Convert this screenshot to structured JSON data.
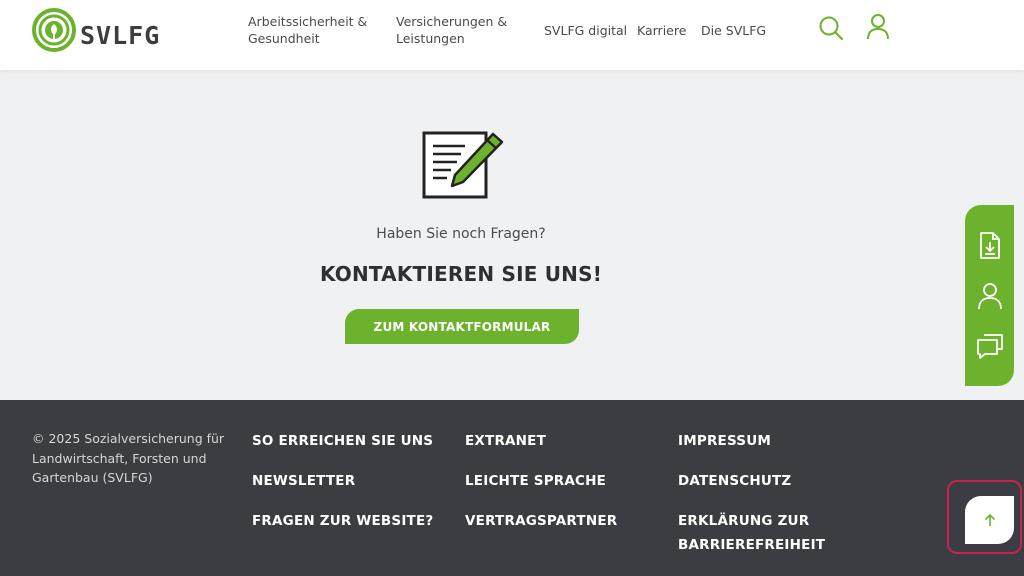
{
  "header": {
    "logo_text": "SVLFG",
    "nav": [
      {
        "label_line1": "Arbeitssicherheit &",
        "label_line2": "Gesundheit"
      },
      {
        "label_line1": "Versicherungen &",
        "label_line2": "Leistungen"
      },
      {
        "label_line1": "SVLFG digital",
        "label_line2": ""
      },
      {
        "label_line1": "Karriere",
        "label_line2": ""
      },
      {
        "label_line1": "Die SVLFG",
        "label_line2": ""
      }
    ],
    "icons": {
      "search": "search-icon",
      "account": "user-icon"
    }
  },
  "main": {
    "icon": "document-edit-icon",
    "question": "Haben Sie noch Fragen?",
    "headline": "KONTAKTIEREN SIE UNS!",
    "cta_label": "ZUM KONTAKTFORMULAR"
  },
  "side_panel": {
    "items": [
      "download-document-icon",
      "user-icon",
      "chat-icon"
    ]
  },
  "footer": {
    "copyright": "© 2025 Sozialversicherung für Landwirtschaft, Forsten und Gartenbau (SVLFG)",
    "col1": [
      "SO ERREICHEN SIE UNS",
      "NEWSLETTER",
      "FRAGEN ZUR WEBSITE?"
    ],
    "col2": [
      "EXTRANET",
      "LEICHTE SPRACHE",
      "VERTRAGSPARTNER"
    ],
    "col3": [
      "IMPRESSUM",
      "DATENSCHUTZ",
      "ERKLÄRUNG ZUR BARRIEREFREIHEIT"
    ]
  },
  "back_to_top": {
    "icon": "arrow-up-icon"
  },
  "colors": {
    "brand_green": "#6cb22d",
    "footer_bg": "#3c3d42",
    "page_bg": "#f0f1f2",
    "highlight": "#c8234f"
  }
}
